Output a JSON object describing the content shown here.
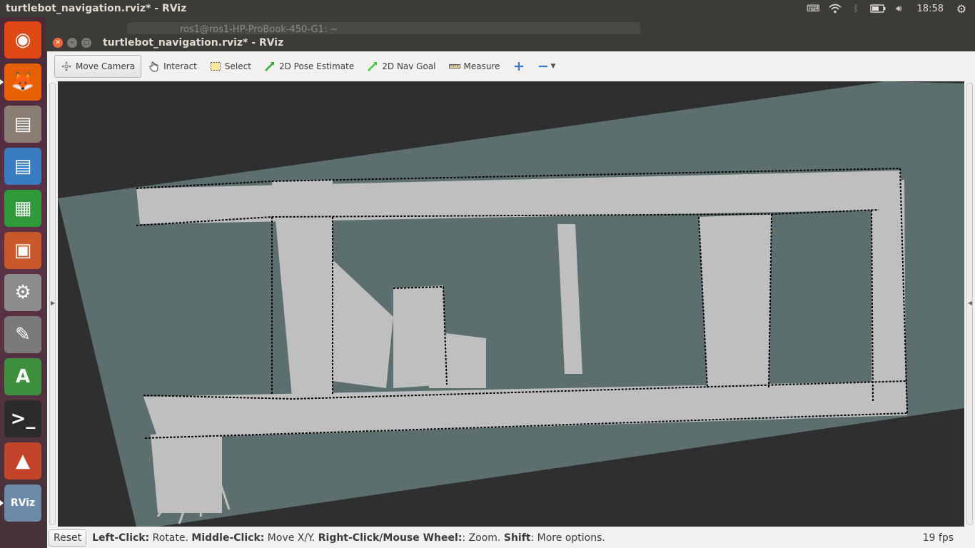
{
  "system": {
    "panel_title": "turtlebot_navigation.rviz* - RViz",
    "clock": "18:58",
    "tray_icons": [
      "keyboard-icon",
      "wifi-icon",
      "bluetooth-icon",
      "battery-icon",
      "volume-icon",
      "settings-gear-icon"
    ]
  },
  "launcher": {
    "items": [
      {
        "name": "ubuntu-dash-icon",
        "glyph": "◉",
        "bg": "#dd4814"
      },
      {
        "name": "firefox-icon",
        "glyph": "🦊",
        "bg": "#e66000"
      },
      {
        "name": "files-icon",
        "glyph": "▤",
        "bg": "#8a7d74"
      },
      {
        "name": "writer-icon",
        "glyph": "▤",
        "bg": "#3a7cc1"
      },
      {
        "name": "calc-icon",
        "glyph": "▦",
        "bg": "#2e9a3a"
      },
      {
        "name": "impress-icon",
        "glyph": "▣",
        "bg": "#c9592b"
      },
      {
        "name": "system-settings-icon",
        "glyph": "⚙",
        "bg": "#8c8c8c"
      },
      {
        "name": "text-editor-icon",
        "glyph": "✎",
        "bg": "#7a7a7a"
      },
      {
        "name": "software-updater-icon",
        "glyph": "A",
        "bg": "#3d8f3d"
      },
      {
        "name": "terminal-icon",
        "glyph": ">_",
        "bg": "#2b2b2b"
      },
      {
        "name": "matlab-icon",
        "glyph": "▲",
        "bg": "#c1442a"
      },
      {
        "name": "rviz-icon",
        "glyph": "RViz",
        "bg": "#6c8aa8"
      }
    ]
  },
  "background_window": {
    "title": "ros1@ros1-HP-ProBook-450-G1: ~"
  },
  "window": {
    "title": "turtlebot_navigation.rviz* - RViz"
  },
  "toolbar": {
    "move_camera": "Move Camera",
    "interact": "Interact",
    "select": "Select",
    "pose_estimate": "2D Pose Estimate",
    "nav_goal": "2D Nav Goal",
    "measure": "Measure"
  },
  "statusbar": {
    "reset": "Reset",
    "left_click": "Left-Click:",
    "left_click_desc": " Rotate. ",
    "middle_click": "Middle-Click:",
    "middle_click_desc": " Move X/Y. ",
    "right_click": "Right-Click/Mouse Wheel:",
    "right_click_desc": ": Zoom. ",
    "shift": "Shift",
    "shift_desc": ": More options.",
    "fps": "19 fps"
  },
  "colors": {
    "map_unknown": "#5d6e6e",
    "map_free": "#bfbfbf",
    "map_occupied": "#000000",
    "viewport_bg": "#2f2f2f"
  }
}
